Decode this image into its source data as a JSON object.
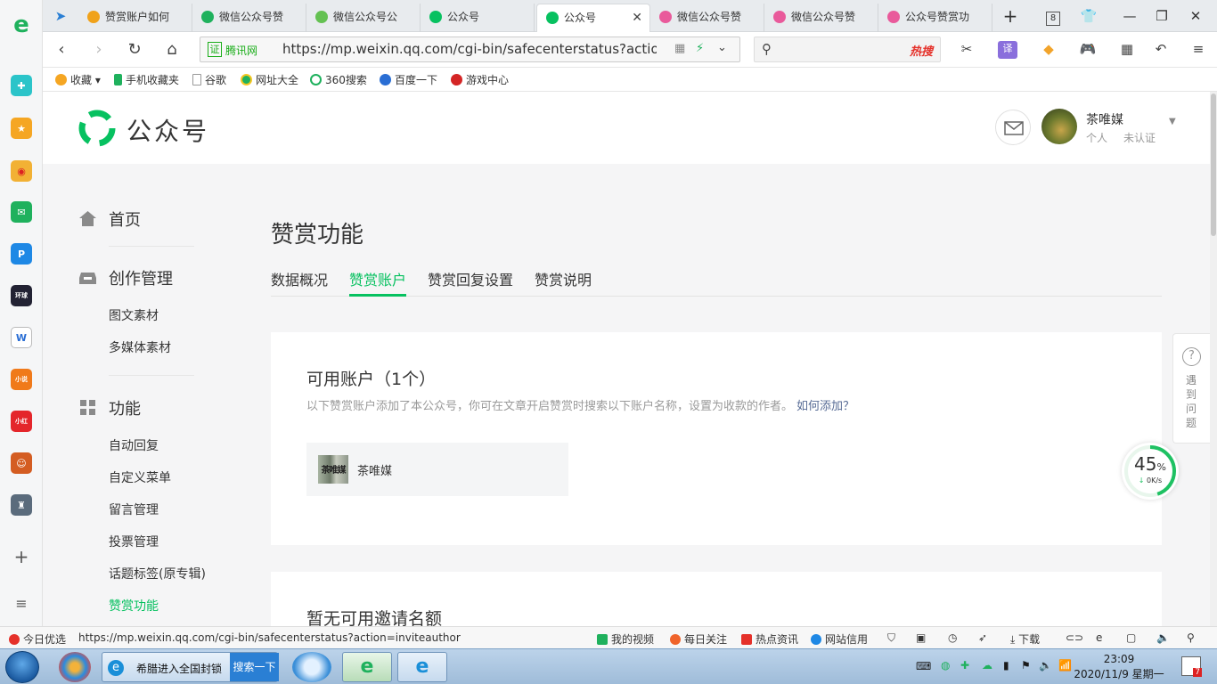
{
  "browser": {
    "tabs": [
      {
        "label": "赞赏账户如何"
      },
      {
        "label": "微信公众号赞"
      },
      {
        "label": "微信公众号公"
      },
      {
        "label": "公众号"
      },
      {
        "label": "公众号"
      },
      {
        "label": "微信公众号赞"
      },
      {
        "label": "微信公众号赞"
      },
      {
        "label": "公众号赞赏功"
      }
    ],
    "tab_count": "8",
    "site_badge": "腾讯网",
    "url": "https://mp.weixin.qq.com/cgi-bin/safecenterstatus?action=invit",
    "search_hot": "热搜",
    "bookmarks": [
      "收藏",
      "手机收藏夹",
      "谷歌",
      "网址大全",
      "360搜索",
      "百度一下",
      "游戏中心"
    ]
  },
  "header": {
    "brand": "公众号",
    "user_name": "茶唯媒",
    "user_type": "个人",
    "user_status": "未认证"
  },
  "sidebar": {
    "home": "首页",
    "create": "创作管理",
    "create_items": [
      "图文素材",
      "多媒体素材"
    ],
    "func": "功能",
    "func_items": [
      "自动回复",
      "自定义菜单",
      "留言管理",
      "投票管理",
      "话题标签(原专辑)",
      "赞赏功能"
    ]
  },
  "main": {
    "title": "赞赏功能",
    "tabs": [
      "数据概况",
      "赞赏账户",
      "赞赏回复设置",
      "赞赏说明"
    ],
    "active_tab": "赞赏账户",
    "available_title": "可用账户（1个）",
    "available_desc": "以下赞赏账户添加了本公众号，你可在文章开启赞赏时搜索以下账户名称，设置为收款的作者。",
    "how_to_add": "如何添加？",
    "account_thumb_text": "茶唯媒",
    "account_name": "茶唯媒",
    "invite_title": "暂无可用邀请名额"
  },
  "help": {
    "text": "遇到问题"
  },
  "speed": {
    "percent": "45",
    "percent_unit": "%",
    "rate": "0K/s",
    "progress": 0.45
  },
  "statusbar": {
    "today": "今日优选",
    "url": "https://mp.weixin.qq.com/cgi-bin/safecenterstatus?action=inviteauthor",
    "items": [
      "我的视频",
      "每日关注",
      "热点资讯",
      "网站信用",
      "下载"
    ]
  },
  "taskbar": {
    "task_label": "希腊进入全国封锁",
    "task_search": "搜索一下",
    "time": "23:09",
    "date": "2020/11/9 星期一",
    "badge": "7"
  },
  "colors": {
    "accent": "#07c160",
    "link": "#576b95"
  }
}
